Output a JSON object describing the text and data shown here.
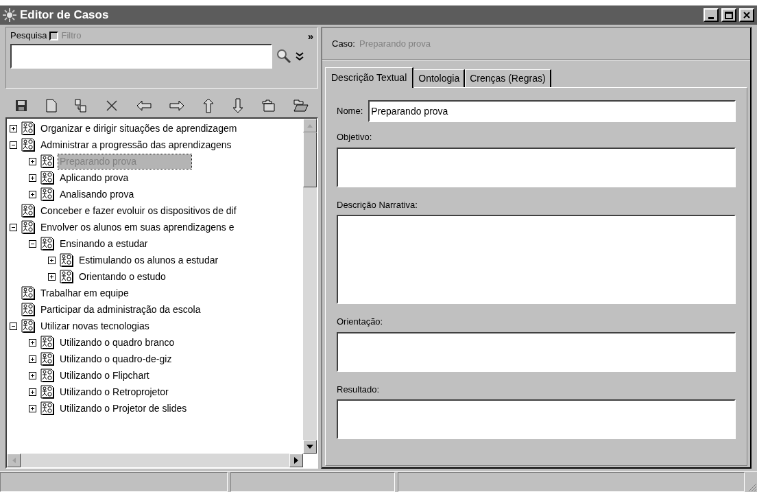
{
  "window": {
    "title": "Editor de Casos"
  },
  "search": {
    "label": "Pesquisa",
    "filter": {
      "label": "Filtro",
      "checked": false,
      "disabled": true
    },
    "collapse_glyph": "»"
  },
  "tree": {
    "items": [
      {
        "label": "Organizar e dirigir situações de aprendizagem",
        "expanded": false,
        "selected": false
      },
      {
        "label": "Administrar a progressão das aprendizagens",
        "expanded": true,
        "selected": false,
        "children": [
          {
            "label": "Preparando prova",
            "expanded": false,
            "selected": true
          },
          {
            "label": "Aplicando prova",
            "expanded": false,
            "selected": false
          },
          {
            "label": "Analisando prova",
            "expanded": false,
            "selected": false
          }
        ]
      },
      {
        "label": "Conceber e fazer evoluir os dispositivos de dif",
        "selected": false
      },
      {
        "label": "Envolver os alunos em suas aprendizagens e",
        "expanded": true,
        "selected": false,
        "children": [
          {
            "label": "Ensinando a estudar",
            "expanded": true,
            "selected": false,
            "children": [
              {
                "label": "Estimulando os alunos a estudar",
                "expanded": false,
                "selected": false
              },
              {
                "label": "Orientando o estudo",
                "expanded": false,
                "selected": false
              }
            ]
          }
        ]
      },
      {
        "label": "Trabalhar em equipe",
        "selected": false
      },
      {
        "label": "Participar da administração da escola",
        "selected": false
      },
      {
        "label": "Utilizar novas tecnologias",
        "expanded": true,
        "selected": false,
        "children": [
          {
            "label": "Utilizando o quadro branco",
            "expanded": false,
            "selected": false
          },
          {
            "label": "Utilizando o quadro-de-giz",
            "expanded": false,
            "selected": false
          },
          {
            "label": "Utilizando o Flipchart",
            "expanded": false,
            "selected": false
          },
          {
            "label": "Utilizando o Retroprojetor",
            "expanded": false,
            "selected": false
          },
          {
            "label": "Utilizando o Projetor de slides",
            "expanded": false,
            "selected": false
          }
        ]
      }
    ]
  },
  "case": {
    "label": "Caso:",
    "value": "Preparando prova"
  },
  "tabs": [
    {
      "label": "Descrição Textual",
      "selected": true
    },
    {
      "label": "Ontologia",
      "selected": false
    },
    {
      "label": "Crenças (Regras)",
      "selected": false
    }
  ],
  "form": {
    "fields": [
      {
        "kind": "line",
        "label": "Nome:",
        "value": "Preparando prova"
      },
      {
        "kind": "area",
        "label": "Objetivo:"
      },
      {
        "kind": "large_area",
        "label": "Descrição Narrativa:"
      },
      {
        "kind": "area",
        "label": "Orientação:"
      },
      {
        "kind": "area",
        "label": "Resultado:"
      }
    ]
  }
}
